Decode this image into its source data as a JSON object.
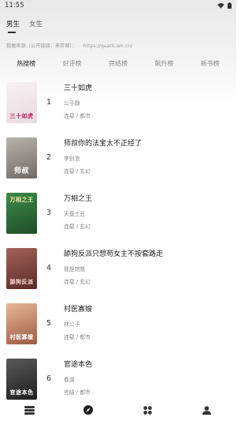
{
  "status": {
    "time": "11:55"
  },
  "gender_tabs": [
    {
      "label": "男生",
      "active": true
    },
    {
      "label": "女生",
      "active": false
    }
  ],
  "source": {
    "label": "数据来源（公开链接，来存储）：",
    "url": "https://quark.sm.cn/"
  },
  "rank_tabs": [
    {
      "label": "热搜榜",
      "active": true
    },
    {
      "label": "好评榜",
      "active": false
    },
    {
      "label": "完结榜",
      "active": false
    },
    {
      "label": "飙升榜",
      "active": false
    },
    {
      "label": "新书榜",
      "active": false
    }
  ],
  "books": [
    {
      "rank": "1",
      "title": "三十如虎",
      "author": "公子靜",
      "meta": "连载 / 都市",
      "cover_text": "三十如虎",
      "cover_bg": "#f4eef0",
      "cover_fg": "#c2185b"
    },
    {
      "rank": "2",
      "title": "师叔你的法宝太不正经了",
      "author": "李别浪",
      "meta": "连载 / 玄幻",
      "cover_text": "师叔",
      "cover_bg": "#8e8a86",
      "cover_fg": "#ffffff"
    },
    {
      "rank": "3",
      "title": "万相之王",
      "author": "天蚕土豆",
      "meta": "连载 / 玄幻",
      "cover_text": "万相之王",
      "cover_bg": "#2e6b3a",
      "cover_fg": "#ffe9a8"
    },
    {
      "rank": "4",
      "title": "舔狗反派只想苟女主不按套路走",
      "author": "我是馆慈",
      "meta": "连载 / 玄幻",
      "cover_text": "舔狗反派",
      "cover_bg": "#7a3e3a",
      "cover_fg": "#ffd9d0"
    },
    {
      "rank": "5",
      "title": "村医寡嫂",
      "author": "林公子",
      "meta": "连载 / 都市",
      "cover_text": "村医寡嫂",
      "cover_bg": "#c98a6a",
      "cover_fg": "#ffffff"
    },
    {
      "rank": "6",
      "title": "官途本色",
      "author": "春湖",
      "meta": "完结 / 都市",
      "cover_text": "官途本色",
      "cover_bg": "#3b3b3b",
      "cover_fg": "#ffffff"
    }
  ],
  "bottom_nav": [
    {
      "icon": "bookshelf-icon"
    },
    {
      "icon": "compass-icon"
    },
    {
      "icon": "grid-icon"
    },
    {
      "icon": "user-icon"
    }
  ]
}
